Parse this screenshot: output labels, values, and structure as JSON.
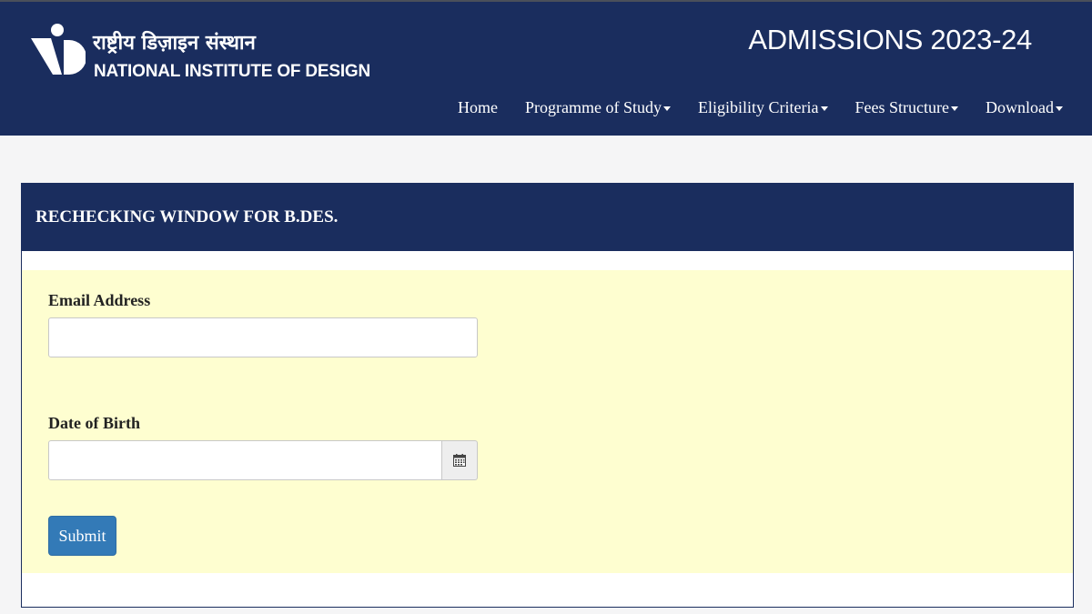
{
  "header": {
    "logo_icon": "nid-logo-icon",
    "institute_name_hindi": "राष्ट्रीय डिज़ाइन संस्थान",
    "institute_name_english": "NATIONAL INSTITUTE OF DESIGN",
    "admissions_title": "ADMISSIONS 2023-24",
    "background_color": "#1a2d5e"
  },
  "nav": {
    "items": [
      {
        "label": "Home",
        "has_dropdown": false
      },
      {
        "label": "Programme of Study",
        "has_dropdown": true
      },
      {
        "label": "Eligibility Criteria",
        "has_dropdown": true
      },
      {
        "label": "Fees Structure",
        "has_dropdown": true
      },
      {
        "label": "Download",
        "has_dropdown": true
      }
    ]
  },
  "panel": {
    "title": "RECHECKING WINDOW FOR B.DES.",
    "form_background": "#fefed0"
  },
  "form": {
    "email_label": "Email Address",
    "email_value": "",
    "dob_label": "Date of Birth",
    "dob_value": "",
    "calendar_icon": "calendar-icon",
    "submit_label": "Submit",
    "submit_color": "#337ab7"
  }
}
